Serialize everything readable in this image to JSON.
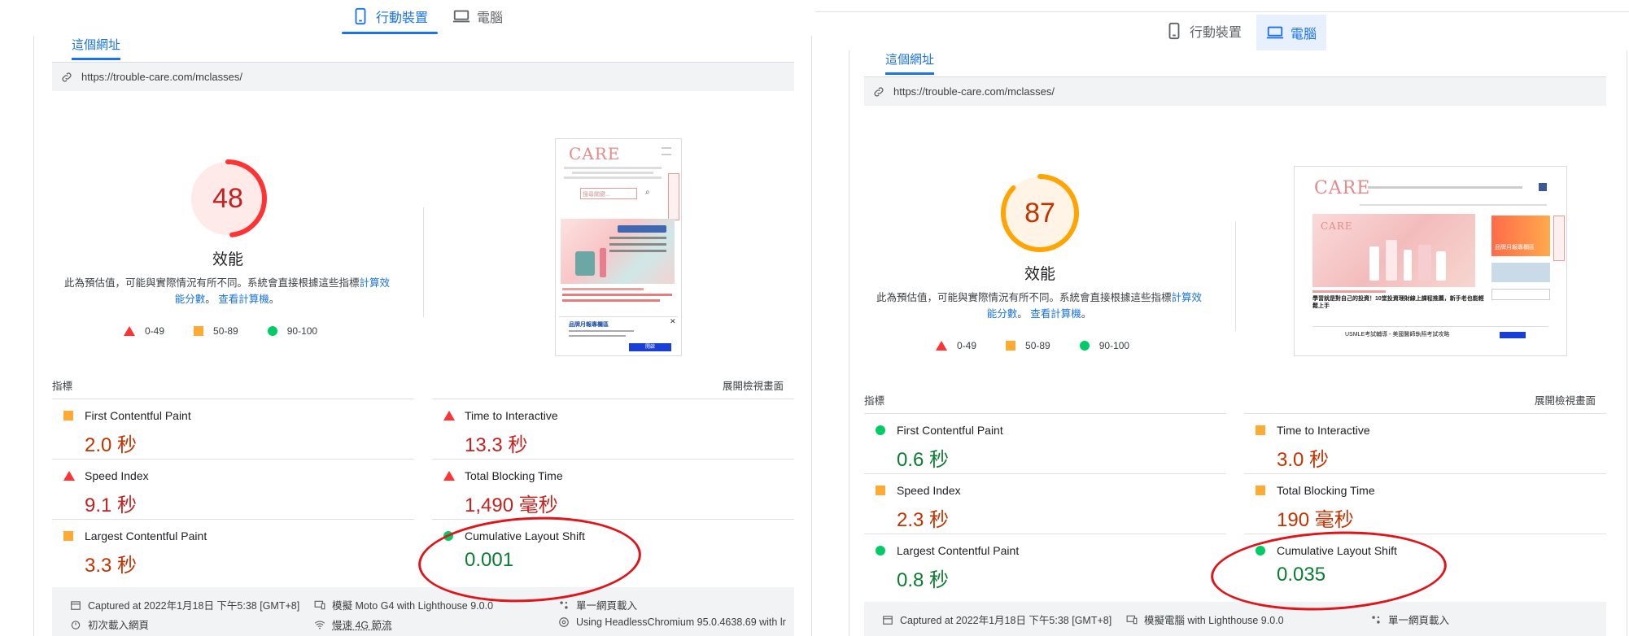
{
  "device_tabs": {
    "mobile": "行動裝置",
    "desktop": "電腦"
  },
  "url_tab": "這個網址",
  "url": "https://trouble-care.com/mclasses/",
  "gauge_title": "效能",
  "desc": {
    "text": "此為預估值，可能與實際情況有所不同。系統會直接根據這些指標",
    "link1": "計算效能分數",
    "middle": "。",
    "link2": "查看計算機",
    "end": "。"
  },
  "legend": {
    "fail": "0-49",
    "average": "50-89",
    "pass": "90-100"
  },
  "metrics_label": "指標",
  "expand_label": "展開檢視畫面",
  "metric_names": {
    "fcp": "First Contentful Paint",
    "tti": "Time to Interactive",
    "si": "Speed Index",
    "tbt": "Total Blocking Time",
    "lcp": "Largest Contentful Paint",
    "cls": "Cumulative Layout Shift"
  },
  "colors": {
    "fail": "#ff3333",
    "average": "#ffaa33",
    "pass": "#00cc66",
    "accent": "#1a73e8",
    "annotation": "#e0151b"
  },
  "screenshot_site": {
    "logo": "CARE",
    "search_placeholder": "搜尋關鍵...",
    "mobile_ad_title": "品牌月報專欄區",
    "mobile_ad_button": "開啟",
    "desktop_headline": "學習就是對自己的投資！10堂投資理財線上課程推薦，新手老也能輕鬆上手",
    "desktop_footer_ad": "USMLE考試輔導 - 美國醫師執照考試攻略",
    "desktop_ad_label": "品牌月報專欄區"
  },
  "left": {
    "score": "48",
    "metrics": {
      "fcp": "2.0 秒",
      "tti": "13.3 秒",
      "si": "9.1 秒",
      "tbt": "1,490 毫秒",
      "lcp": "3.3 秒",
      "cls": "0.001"
    },
    "footer": {
      "captured": "Captured at 2022年1月18日 下午5:38 [GMT+8]",
      "emulated": "模擬 Moto G4 with Lighthouse 9.0.0",
      "single": "單一網頁載入",
      "initial": "初次載入網頁",
      "throttle": "慢速 4G 節流",
      "browser": "Using HeadlessChromium 95.0.4638.69 with lr"
    }
  },
  "right": {
    "score": "87",
    "metrics": {
      "fcp": "0.6 秒",
      "tti": "3.0 秒",
      "si": "2.3 秒",
      "tbt": "190 毫秒",
      "lcp": "0.8 秒",
      "cls": "0.035"
    },
    "footer": {
      "captured": "Captured at 2022年1月18日 下午5:38 [GMT+8]",
      "emulated": "模擬電腦 with Lighthouse 9.0.0",
      "single": "單一網頁載入"
    }
  }
}
